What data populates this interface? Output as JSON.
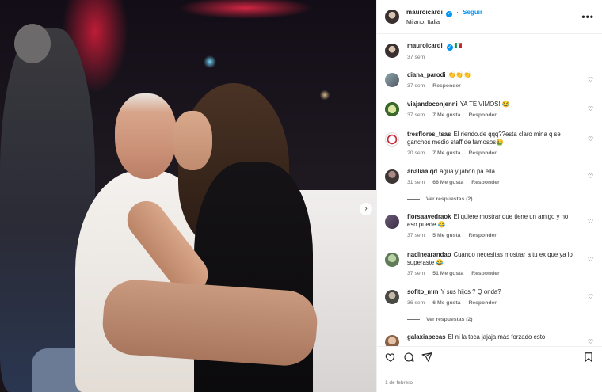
{
  "post": {
    "username": "mauroicardi",
    "follow_label": "Seguir",
    "location": "Milano, Italia",
    "more_label": "•••",
    "caption_user": "mauroicardi",
    "caption_text": "🇮🇹",
    "caption_age": "37 sem",
    "date": "1 de febrero"
  },
  "comments": [
    {
      "user": "diana_parodi",
      "text": "👏👏👏",
      "age": "37 sem",
      "likes": "",
      "reply": "Responder"
    },
    {
      "user": "viajandoconjenni",
      "text": "YA TE VIMOS! 😂",
      "age": "37 sem",
      "likes": "7 Me gusta",
      "reply": "Responder"
    },
    {
      "user": "tresflores_tsas",
      "text": "El riendo.de qqq??esta claro mina q se ganchos medio staff de famosos🤮",
      "age": "20 sem",
      "likes": "7 Me gusta",
      "reply": "Responder"
    },
    {
      "user": "analiaa.qd",
      "text": "agua y jabón pa ella",
      "age": "31 sem",
      "likes": "66 Me gusta",
      "reply": "Responder"
    },
    {
      "user": "florsaavedraok",
      "text": "El quiere mostrar que tiene un amigo y no eso puede 😂",
      "age": "37 sem",
      "likes": "5 Me gusta",
      "reply": "Responder"
    },
    {
      "user": "nadinearandao",
      "text": "Cuando necesitas mostrar a tu ex que ya lo superaste 😂",
      "age": "37 sem",
      "likes": "51 Me gusta",
      "reply": "Responder"
    },
    {
      "user": "sofito_mm",
      "text": "Y sus hijos ? Q onda?",
      "age": "36 sem",
      "likes": "6 Me gusta",
      "reply": "Responder"
    },
    {
      "user": "galaxiapecas",
      "text": "El ni la toca jajaja más forzado esto",
      "age": "",
      "likes": "",
      "reply": ""
    }
  ],
  "view_replies": [
    "Ver respuestas (2)",
    "Ver respuestas (2)"
  ],
  "icons": {
    "heart": "♡",
    "comment": "comment-icon",
    "share": "share-icon",
    "save": "bookmark-icon",
    "next": "›"
  },
  "colors": {
    "accent": "#0095f6",
    "text": "#262626",
    "muted": "#737373"
  }
}
